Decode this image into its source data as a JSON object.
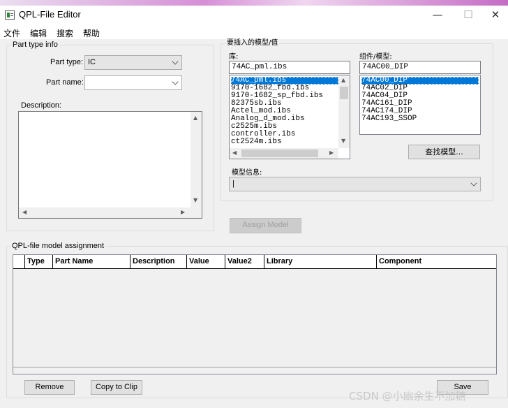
{
  "window": {
    "title": "QPL-File Editor",
    "minimize_glyph": "—",
    "maximize_glyph": "☐",
    "close_glyph": "✕"
  },
  "menu": [
    "文件",
    "编辑",
    "搜索",
    "帮助"
  ],
  "part_type_info": {
    "group_label": "Part type info",
    "part_type_label": "Part type:",
    "part_type_value": "IC",
    "part_name_label": "Part name:",
    "part_name_value": "",
    "description_label": "Description:",
    "description_value": ""
  },
  "model_insert": {
    "group_label": "要插入的模型/值",
    "library_label": "库:",
    "library_input": "74AC_pml.ibs",
    "library_items": [
      "74AC_pml.ibs",
      "9170-1682_fbd.ibs",
      "9170-1682_sp_fbd.ibs",
      "82375sb.ibs",
      "Actel_mod.ibs",
      "Analog_d_mod.ibs",
      "c2525m.ibs",
      "controller.ibs",
      "ct2524m.ibs"
    ],
    "library_selected_index": 0,
    "component_label": "组件/模型:",
    "component_input": "74AC00_DIP",
    "component_items": [
      "74AC00_DIP",
      "74AC02_DIP",
      "74AC04_DIP",
      "74AC161_DIP",
      "74AC174_DIP",
      "74AC193_SSOP"
    ],
    "component_selected_index": 0,
    "find_model_button": "查找模型...",
    "model_info_label": "模型信息:",
    "model_info_value": "|"
  },
  "assign_model_button": "Assign Model",
  "assignment": {
    "group_label": "QPL-file model assignment",
    "columns": [
      "Type",
      "Part Name",
      "Description",
      "Value",
      "Value2",
      "Library",
      "Component"
    ],
    "rows": []
  },
  "buttons": {
    "remove": "Remove",
    "copy_to_clip": "Copy to Clip",
    "save": "Save"
  },
  "watermark": "CSDN @小幽余生不加糖"
}
